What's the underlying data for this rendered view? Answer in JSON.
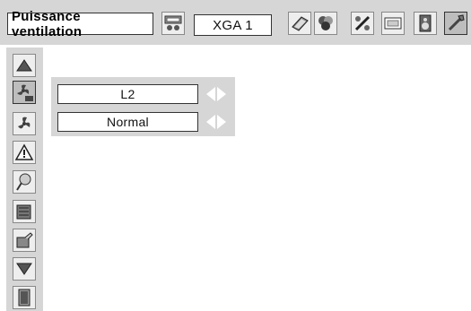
{
  "header": {
    "title": "Puissance ventilation",
    "input_source": "XGA 1",
    "toolbar_icons": [
      "input-connector-icon",
      "pc-adjust-icon",
      "color-select-icon",
      "image-adjust-icon",
      "screen-icon",
      "sound-icon",
      "setting-icon"
    ]
  },
  "sidebar": {
    "items": [
      "up-arrow-icon",
      "fan-off-icon",
      "fan-icon",
      "warning-icon",
      "lamp-icon",
      "filter-icon",
      "key-lock-icon",
      "down-arrow-icon",
      "exit-door-icon"
    ]
  },
  "panel": {
    "rows": [
      {
        "value": "L2"
      },
      {
        "value": "Normal"
      }
    ]
  }
}
